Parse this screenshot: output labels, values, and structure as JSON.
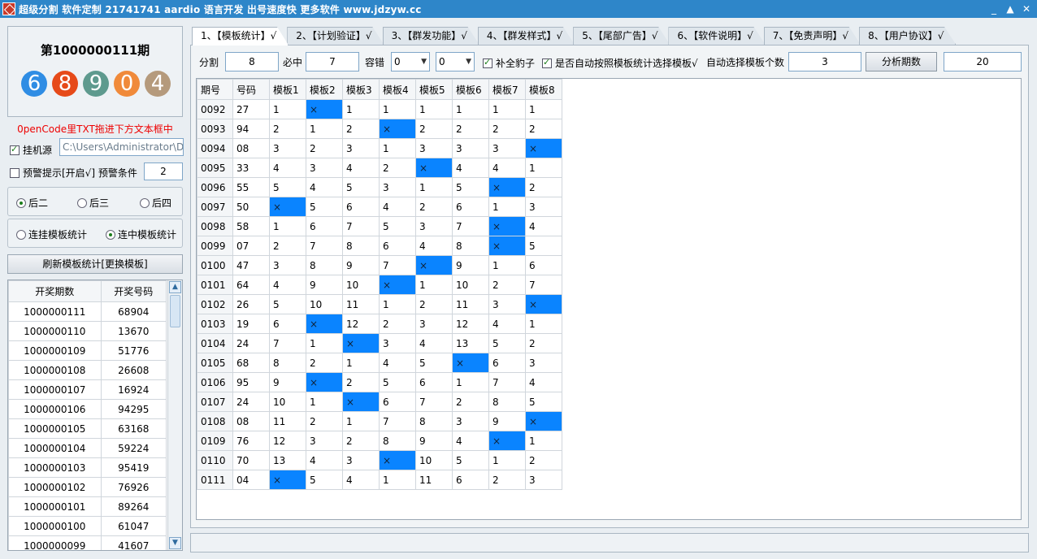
{
  "window": {
    "title": "超级分割 软件定制 21741741 aardio 语言开发 出号速度快 更多软件 www.jdzyw.cc",
    "buttons": [
      "_",
      "▲",
      "✕"
    ]
  },
  "left": {
    "issue_title": "第1000000111期",
    "balls": [
      {
        "digit": "6",
        "color": "#2f8de4"
      },
      {
        "digit": "8",
        "color": "#e64a19"
      },
      {
        "digit": "9",
        "color": "#5e9a8e"
      },
      {
        "digit": "0",
        "color": "#f08a3a"
      },
      {
        "digit": "4",
        "color": "#b59a7c"
      }
    ],
    "hint": "0penCode里TXT拖进下方文本框中",
    "source_checkbox": {
      "label": "挂机源",
      "checked": true
    },
    "path_value": "C:\\Users\\Administrator\\De",
    "warning": {
      "label": "预警提示[开启√] 预警条件",
      "checked": false,
      "value": "2"
    },
    "position_radios": [
      {
        "label": "后二",
        "checked": true
      },
      {
        "label": "后三",
        "checked": false
      },
      {
        "label": "后四",
        "checked": false
      }
    ],
    "stat_radios": [
      {
        "label": "连挂模板统计",
        "checked": false
      },
      {
        "label": "连中模板统计",
        "checked": true
      }
    ],
    "refresh_label": "刷新模板统计[更换模板]",
    "draw_headers": [
      "开奖期数",
      "开奖号码"
    ],
    "draws": [
      [
        "1000000111",
        "68904"
      ],
      [
        "1000000110",
        "13670"
      ],
      [
        "1000000109",
        "51776"
      ],
      [
        "1000000108",
        "26608"
      ],
      [
        "1000000107",
        "16924"
      ],
      [
        "1000000106",
        "94295"
      ],
      [
        "1000000105",
        "63168"
      ],
      [
        "1000000104",
        "59224"
      ],
      [
        "1000000103",
        "95419"
      ],
      [
        "1000000102",
        "76926"
      ],
      [
        "1000000101",
        "89264"
      ],
      [
        "1000000100",
        "61047"
      ],
      [
        "1000000099",
        "41607"
      ]
    ]
  },
  "tabs": [
    "1、【模板统计】√",
    "2、【计划验证】√",
    "3、【群发功能】√",
    "4、【群发样式】√",
    "5、【尾部广告】√",
    "6、【软件说明】√",
    "7、【免责声明】√",
    "8、【用户协议】√"
  ],
  "toolbar": {
    "split_label": "分割",
    "split_value": "8",
    "must_label": "必中",
    "must_value": "7",
    "tolerance_label": "容错",
    "tolerance_a": "0",
    "tolerance_b": "0",
    "complete_label": "补全豹子",
    "auto_label": "是否自动按照模板统计选择模板√",
    "auto_count_label": "自动选择模板个数",
    "auto_count_value": "3",
    "analyze_label": "分析期数",
    "analyze_value": "20"
  },
  "grid": {
    "headers": [
      "期号",
      "号码",
      "模板1",
      "模板2",
      "模板3",
      "模板4",
      "模板5",
      "模板6",
      "模板7",
      "模板8"
    ],
    "rows": [
      [
        "0092",
        "27",
        "1",
        "×",
        "1",
        "1",
        "1",
        "1",
        "1",
        "1"
      ],
      [
        "0093",
        "94",
        "2",
        "1",
        "2",
        "×",
        "2",
        "2",
        "2",
        "2"
      ],
      [
        "0094",
        "08",
        "3",
        "2",
        "3",
        "1",
        "3",
        "3",
        "3",
        "×"
      ],
      [
        "0095",
        "33",
        "4",
        "3",
        "4",
        "2",
        "×",
        "4",
        "4",
        "1"
      ],
      [
        "0096",
        "55",
        "5",
        "4",
        "5",
        "3",
        "1",
        "5",
        "×",
        "2"
      ],
      [
        "0097",
        "50",
        "×",
        "5",
        "6",
        "4",
        "2",
        "6",
        "1",
        "3"
      ],
      [
        "0098",
        "58",
        "1",
        "6",
        "7",
        "5",
        "3",
        "7",
        "×",
        "4"
      ],
      [
        "0099",
        "07",
        "2",
        "7",
        "8",
        "6",
        "4",
        "8",
        "×",
        "5"
      ],
      [
        "0100",
        "47",
        "3",
        "8",
        "9",
        "7",
        "×",
        "9",
        "1",
        "6"
      ],
      [
        "0101",
        "64",
        "4",
        "9",
        "10",
        "×",
        "1",
        "10",
        "2",
        "7"
      ],
      [
        "0102",
        "26",
        "5",
        "10",
        "11",
        "1",
        "2",
        "11",
        "3",
        "×"
      ],
      [
        "0103",
        "19",
        "6",
        "×",
        "12",
        "2",
        "3",
        "12",
        "4",
        "1"
      ],
      [
        "0104",
        "24",
        "7",
        "1",
        "×",
        "3",
        "4",
        "13",
        "5",
        "2"
      ],
      [
        "0105",
        "68",
        "8",
        "2",
        "1",
        "4",
        "5",
        "×",
        "6",
        "3"
      ],
      [
        "0106",
        "95",
        "9",
        "×",
        "2",
        "5",
        "6",
        "1",
        "7",
        "4"
      ],
      [
        "0107",
        "24",
        "10",
        "1",
        "×",
        "6",
        "7",
        "2",
        "8",
        "5"
      ],
      [
        "0108",
        "08",
        "11",
        "2",
        "1",
        "7",
        "8",
        "3",
        "9",
        "×"
      ],
      [
        "0109",
        "76",
        "12",
        "3",
        "2",
        "8",
        "9",
        "4",
        "×",
        "1"
      ],
      [
        "0110",
        "70",
        "13",
        "4",
        "3",
        "×",
        "10",
        "5",
        "1",
        "2"
      ],
      [
        "0111",
        "04",
        "×",
        "5",
        "4",
        "1",
        "11",
        "6",
        "2",
        "3"
      ]
    ],
    "hit_color": "#0a84ff"
  }
}
